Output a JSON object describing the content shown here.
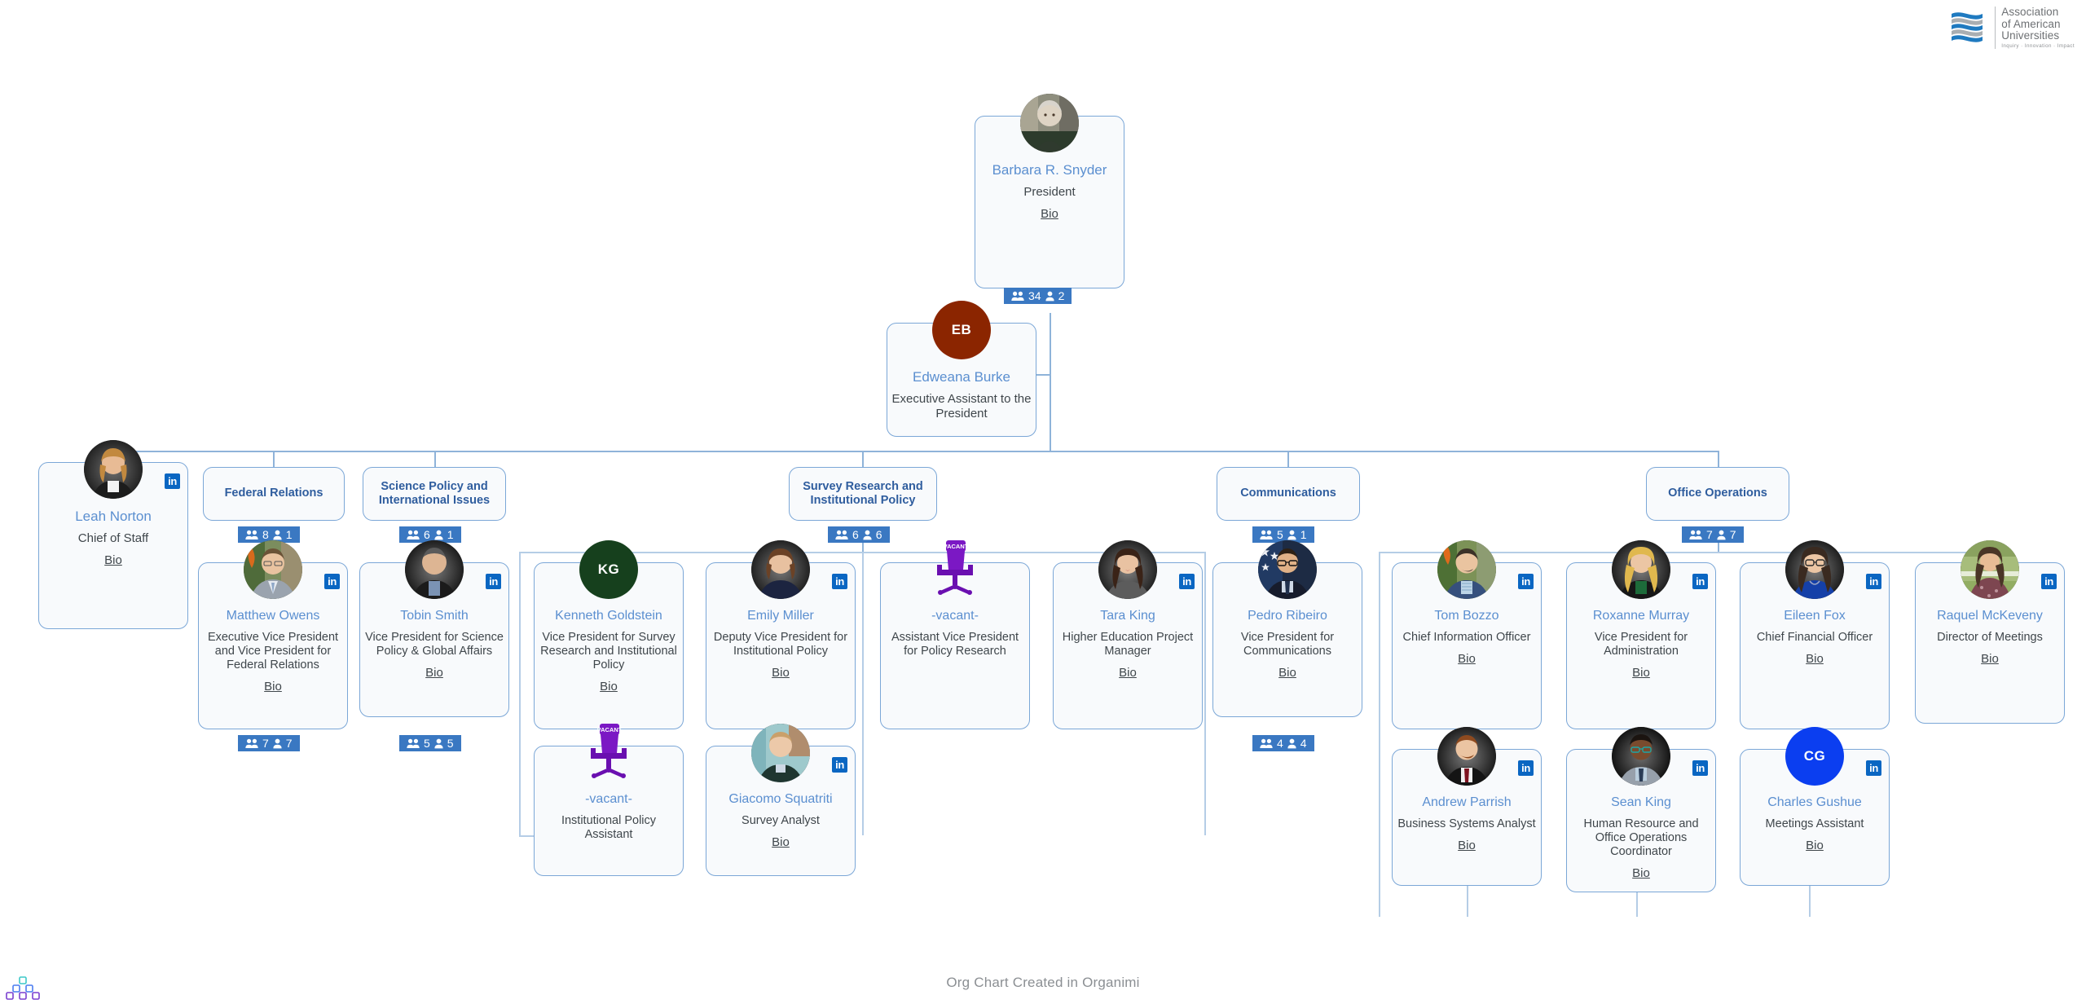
{
  "brand": {
    "logo_icon": "aau-helix-icon",
    "line1": "Association",
    "line2": "of American",
    "line3": "Universities",
    "tagline": "Inquiry · Innovation · Impact"
  },
  "footer": {
    "credit": "Org Chart Created in Organimi",
    "logo_icon": "organimi-pyramid-icon"
  },
  "colors": {
    "card_border": "#7ba7d7",
    "card_bg": "#f8fafc",
    "name_text": "#5b8fd0",
    "group_title": "#2f5d9e",
    "counter_bg": "#3a78c2",
    "linkedin_blue": "#0a66c2",
    "connector": "#8fb3d9",
    "vacant_purple": "#7b18c4",
    "initials_eb_bg": "#8b2500",
    "initials_kg_bg": "#16401d",
    "initials_cg_bg": "#0b3ef0"
  },
  "labels": {
    "bio": "Bio",
    "linkedin": "in",
    "vacant_tag": "VACANT"
  },
  "nodes": {
    "president": {
      "name": "Barbara R. Snyder",
      "title": "President",
      "bio": "Bio",
      "avatar": "photo",
      "linkedin": false,
      "counter": {
        "team": "34",
        "direct": "2"
      }
    },
    "exec_assistant": {
      "name": "Edweana Burke",
      "title": "Executive Assistant to the President",
      "bio": "",
      "avatar": "initials",
      "initials": "EB",
      "linkedin": false
    },
    "chief_of_staff": {
      "name": "Leah Norton",
      "title": "Chief of Staff",
      "bio": "Bio",
      "avatar": "photo",
      "linkedin": true
    }
  },
  "groups": [
    {
      "id": "federal-relations",
      "title": "Federal Relations",
      "counter": {
        "team": "8",
        "direct": "1"
      }
    },
    {
      "id": "science-policy",
      "title": "Science Policy and International Issues",
      "counter": {
        "team": "6",
        "direct": "1"
      }
    },
    {
      "id": "survey-research",
      "title": "Survey Research and Institutional Policy",
      "counter": {
        "team": "6",
        "direct": "6"
      }
    },
    {
      "id": "communications",
      "title": "Communications",
      "counter": {
        "team": "5",
        "direct": "1"
      }
    },
    {
      "id": "office-operations",
      "title": "Office Operations",
      "counter": {
        "team": "7",
        "direct": "7"
      }
    }
  ],
  "people": [
    {
      "id": "matthew-owens",
      "name": "Matthew Owens",
      "title": "Executive Vice President and Vice President for Federal Relations",
      "bio": "Bio",
      "avatar": "photo",
      "linkedin": true,
      "counter": {
        "team": "7",
        "direct": "7"
      }
    },
    {
      "id": "tobin-smith",
      "name": "Tobin Smith",
      "title": "Vice President for Science Policy & Global Affairs",
      "bio": "Bio",
      "avatar": "photo",
      "linkedin": true,
      "counter": {
        "team": "5",
        "direct": "5"
      }
    },
    {
      "id": "kenneth-goldstein",
      "name": "Kenneth Goldstein",
      "title": "Vice President for Survey Research and Institutional Policy",
      "bio": "Bio",
      "avatar": "initials",
      "initials": "KG",
      "linkedin": false
    },
    {
      "id": "vacant-institutional-policy-assistant",
      "name": "-vacant-",
      "title": "Institutional Policy Assistant",
      "bio": "",
      "avatar": "vacant",
      "linkedin": false
    },
    {
      "id": "emily-miller",
      "name": "Emily Miller",
      "title": "Deputy Vice President for Institutional Policy",
      "bio": "Bio",
      "avatar": "photo",
      "linkedin": true
    },
    {
      "id": "giacomo-squatriti",
      "name": "Giacomo Squatriti",
      "title": "Survey Analyst",
      "bio": "Bio",
      "avatar": "photo",
      "linkedin": true
    },
    {
      "id": "vacant-assistant-vp-policy-research",
      "name": "-vacant-",
      "title": "Assistant Vice President for Policy Research",
      "bio": "",
      "avatar": "vacant",
      "linkedin": false
    },
    {
      "id": "tara-king",
      "name": "Tara King",
      "title": "Higher Education Project Manager",
      "bio": "Bio",
      "avatar": "photo",
      "linkedin": true
    },
    {
      "id": "pedro-ribeiro",
      "name": "Pedro Ribeiro",
      "title": "Vice President for Communications",
      "bio": "Bio",
      "avatar": "photo",
      "linkedin": false,
      "counter": {
        "team": "4",
        "direct": "4"
      }
    },
    {
      "id": "tom-bozzo",
      "name": "Tom Bozzo",
      "title": "Chief Information Officer",
      "bio": "Bio",
      "avatar": "photo",
      "linkedin": true
    },
    {
      "id": "andrew-parrish",
      "name": "Andrew Parrish",
      "title": "Business Systems Analyst",
      "bio": "Bio",
      "avatar": "photo",
      "linkedin": true
    },
    {
      "id": "roxanne-murray",
      "name": "Roxanne Murray",
      "title": "Vice President for Administration",
      "bio": "Bio",
      "avatar": "photo",
      "linkedin": true
    },
    {
      "id": "sean-king",
      "name": "Sean King",
      "title": "Human Resource and Office Operations Coordinator",
      "bio": "Bio",
      "avatar": "photo",
      "linkedin": true
    },
    {
      "id": "eileen-fox",
      "name": "Eileen Fox",
      "title": "Chief Financial Officer",
      "bio": "Bio",
      "avatar": "photo",
      "linkedin": true
    },
    {
      "id": "charles-gushue",
      "name": "Charles Gushue",
      "title": "Meetings Assistant",
      "bio": "Bio",
      "avatar": "initials",
      "initials": "CG",
      "linkedin": true
    },
    {
      "id": "raquel-mckeveny",
      "name": "Raquel McKeveny",
      "title": "Director of Meetings",
      "bio": "Bio",
      "avatar": "photo",
      "linkedin": true
    }
  ]
}
